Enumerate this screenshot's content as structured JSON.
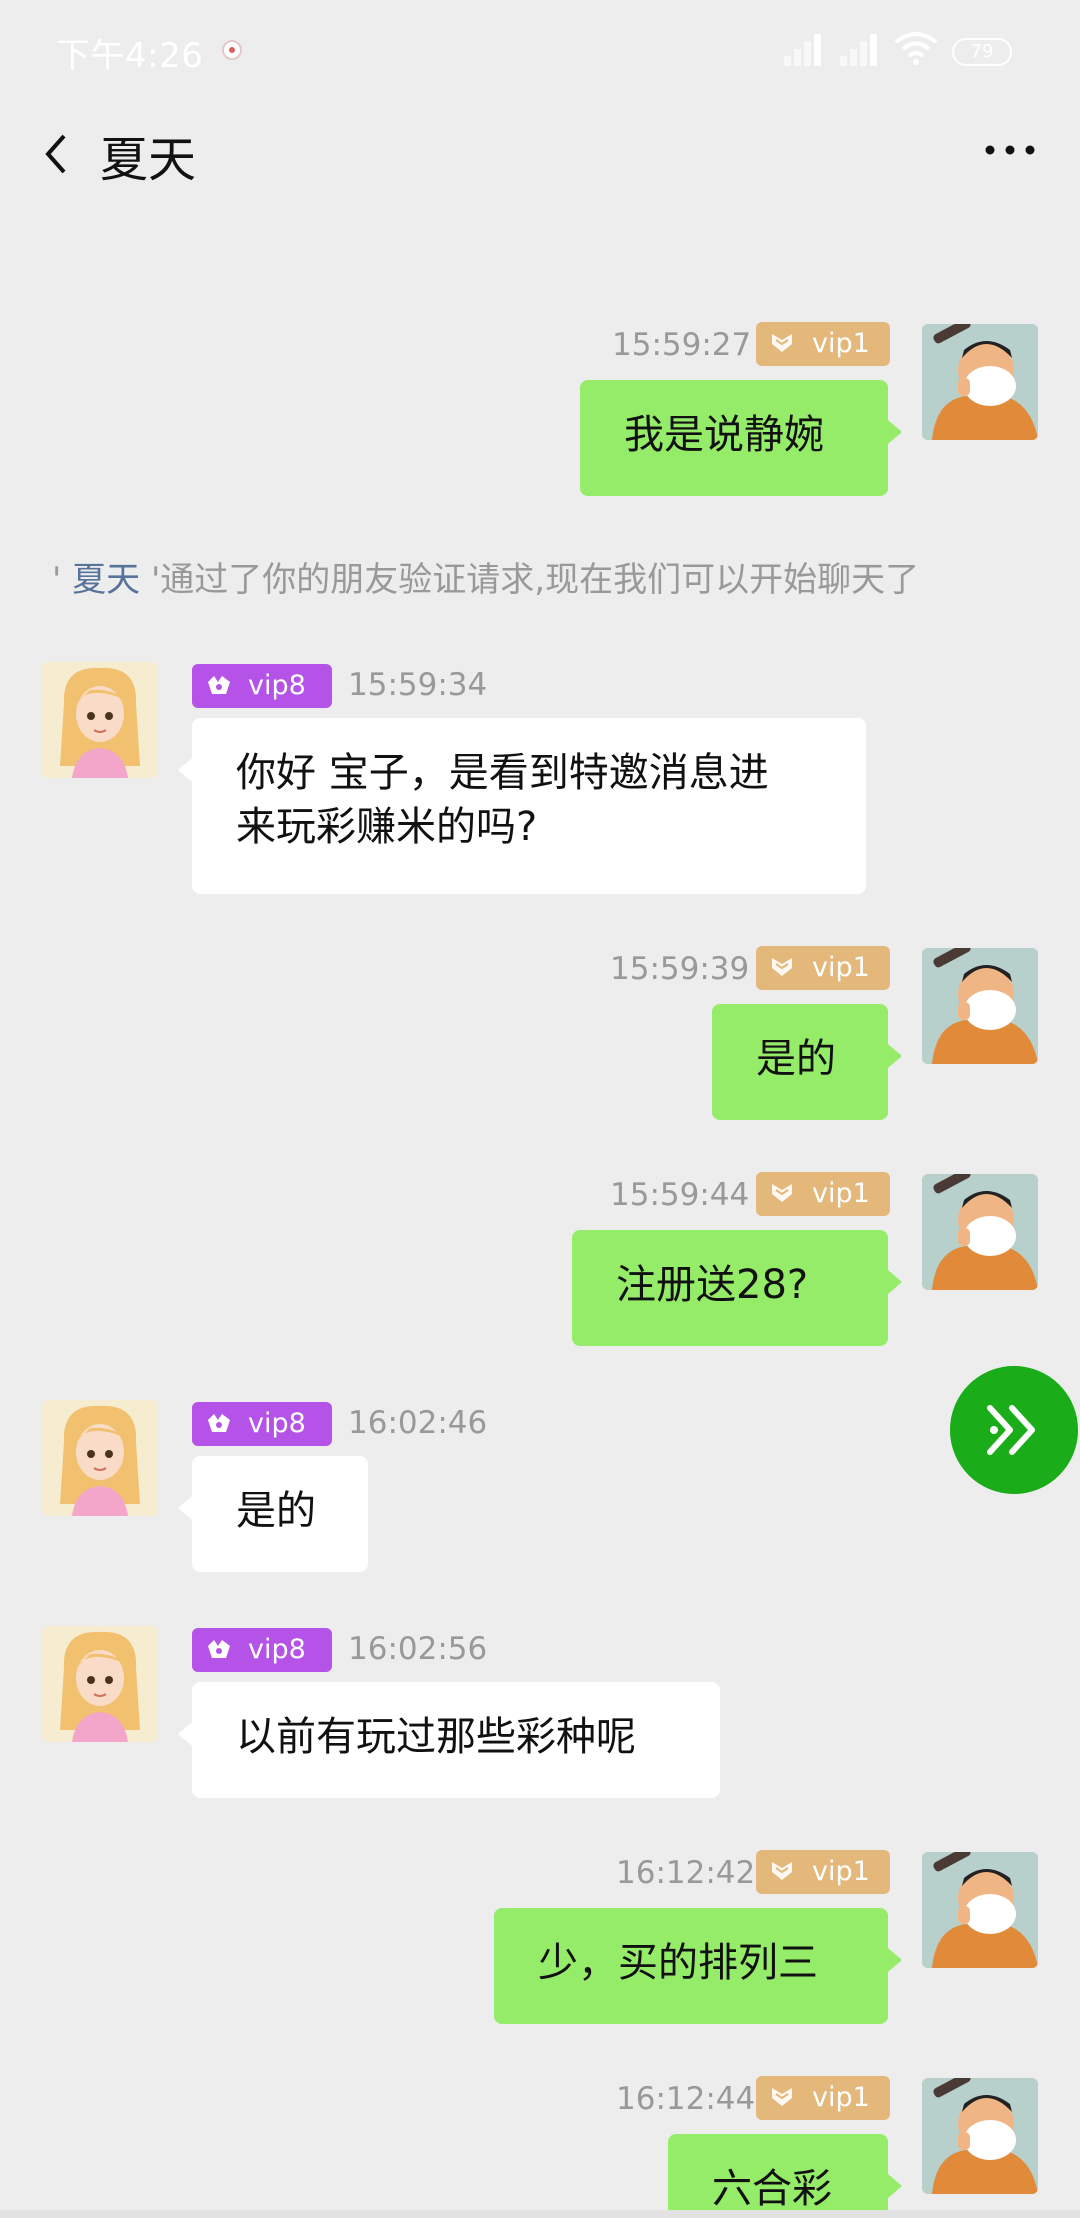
{
  "status_bar": {
    "time": "下午4:26",
    "battery": "79"
  },
  "header": {
    "title": "夏天"
  },
  "system_message": {
    "prefix": "' ",
    "name": "夏天",
    "text": " '通过了你的朋友验证请求,现在我们可以开始聊天了"
  },
  "messages": [
    {
      "side": "me",
      "time": "15:59:27",
      "vip": "vip1",
      "text": "我是说静婉"
    },
    {
      "side": "other",
      "time": "15:59:34",
      "vip": "vip8",
      "text": "你好 宝子，是看到特邀消息进\n来玩彩赚米的吗?"
    },
    {
      "side": "me",
      "time": "15:59:39",
      "vip": "vip1",
      "text": "是的"
    },
    {
      "side": "me",
      "time": "15:59:44",
      "vip": "vip1",
      "text": "注册送28?"
    },
    {
      "side": "other",
      "time": "16:02:46",
      "vip": "vip8",
      "text": "是的"
    },
    {
      "side": "other",
      "time": "16:02:56",
      "vip": "vip8",
      "text": "以前有玩过那些彩种呢"
    },
    {
      "side": "me",
      "time": "16:12:42",
      "vip": "vip1",
      "text": "少，买的排列三"
    },
    {
      "side": "me",
      "time": "16:12:44",
      "vip": "vip1",
      "text": "六合彩"
    }
  ],
  "icons": {
    "back": "chevron-left-icon",
    "more": "more-dots-icon",
    "fab": "double-chevron-right-icon",
    "vip1": "vip-chevron-icon",
    "vip8": "vip-crown-icon"
  },
  "colors": {
    "me_bubble": "#95ec69",
    "other_bubble": "#ffffff",
    "vip1": "#e4b77a",
    "vip8": "#b553e8",
    "fab": "#1aad19",
    "background": "#ededed"
  }
}
